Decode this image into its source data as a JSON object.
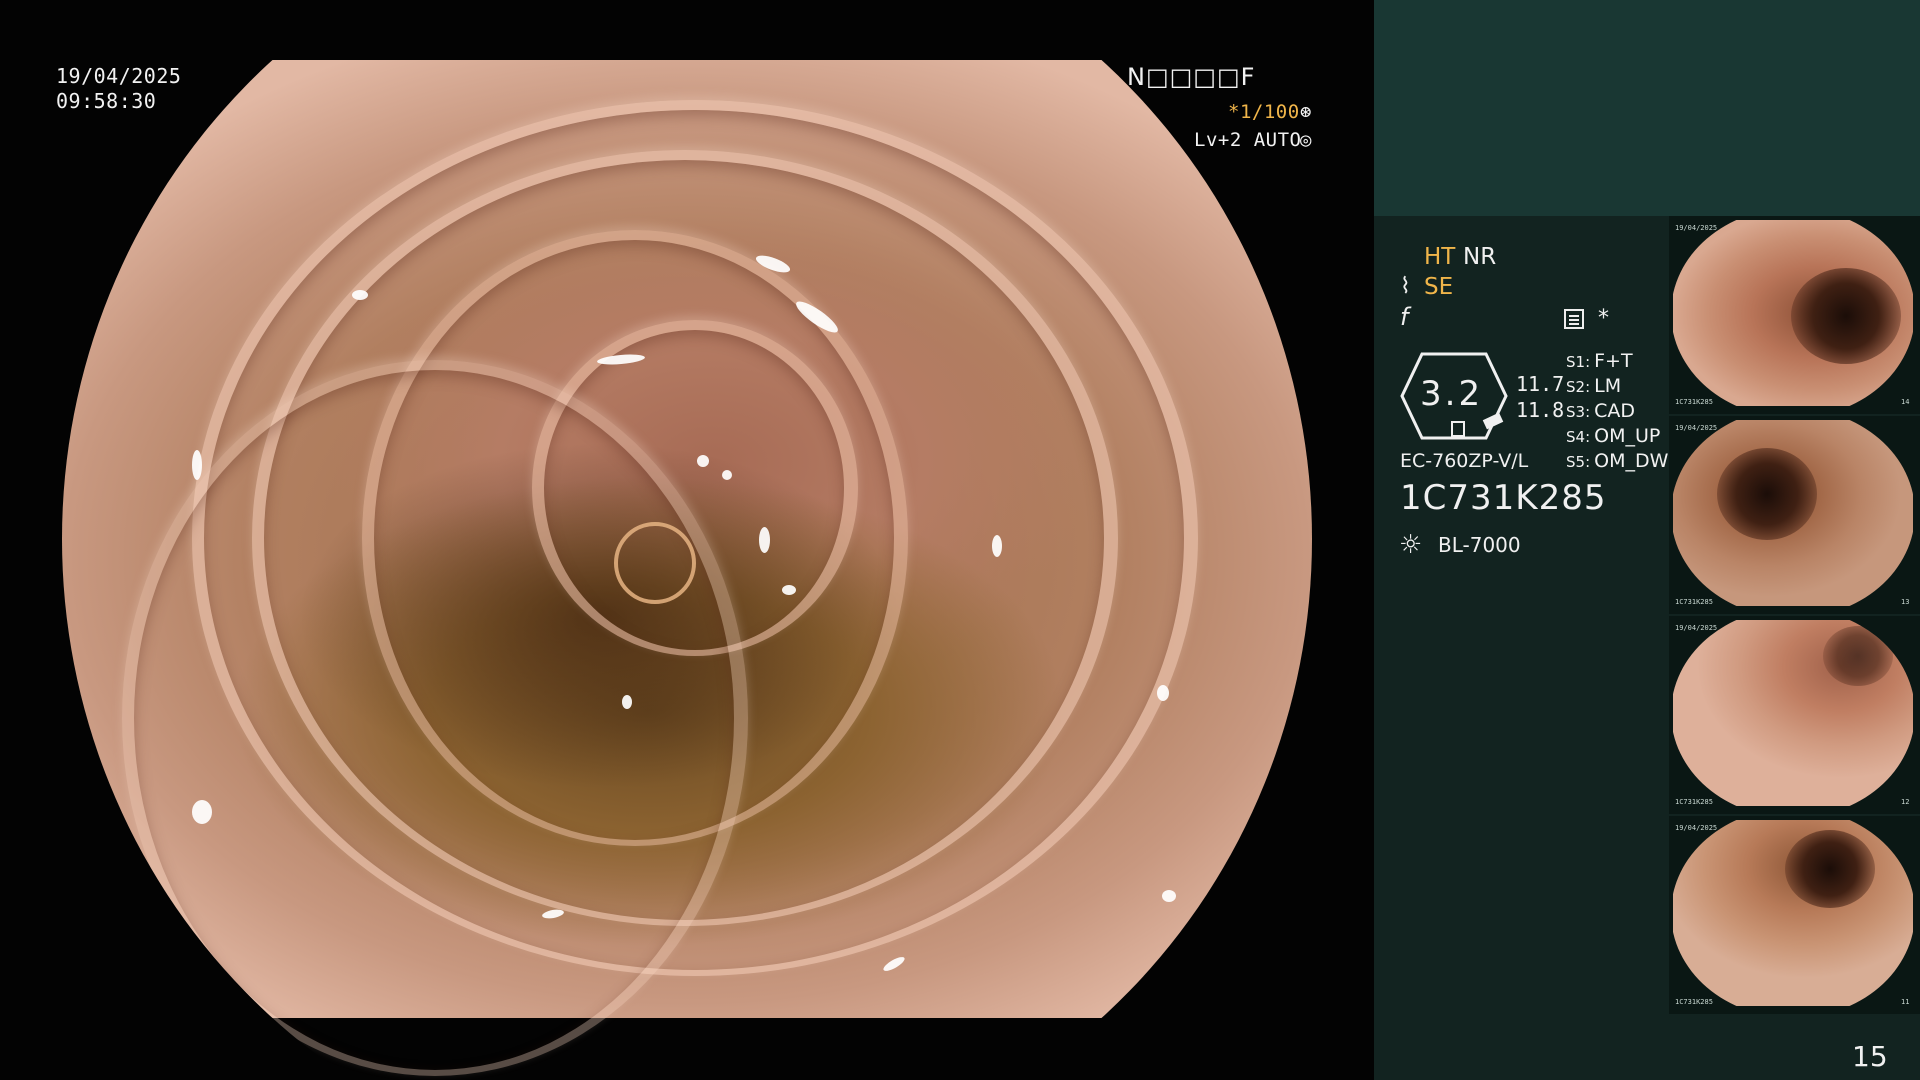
{
  "overlay": {
    "date": "19/04/2025",
    "time": "09:58:30",
    "patient_code": "N□□□□F",
    "shutter": "*1/100",
    "shutter_icon": "aperture-icon",
    "level": "Lv+2 AUTO",
    "auto_icon": "iris-icon"
  },
  "panel": {
    "ht": "HT",
    "nr": "NR",
    "se": "SE",
    "se_icon": "enhance-icon",
    "f_icon": "freeze-icon",
    "mode_icon": "menu-icon",
    "asterisk": "*",
    "hex_value": "3.2",
    "value_1": "11.7",
    "value_2": "11.8",
    "switches": [
      {
        "key": "S1:",
        "value": "F+T"
      },
      {
        "key": "S2:",
        "value": "LM"
      },
      {
        "key": "S3:",
        "value": "CAD"
      },
      {
        "key": "S4:",
        "value": "OM_UP"
      },
      {
        "key": "S5:",
        "value": "OM_DW"
      }
    ],
    "scope_model": "EC-760ZP-V/L",
    "serial": "1C731K285",
    "light_source": "BL-7000",
    "light_icon": "light-icon",
    "page_number": "15"
  },
  "colors": {
    "accent": "#f0b54a",
    "panel_bg": "#122320",
    "panel_top": "#193733",
    "background": "#030303"
  },
  "thumbnails": [
    {
      "code": "1C731K285",
      "index": "14"
    },
    {
      "code": "1C731K285",
      "index": "13"
    },
    {
      "code": "1C731K285",
      "index": "12"
    },
    {
      "code": "1C731K285",
      "index": "11"
    }
  ]
}
